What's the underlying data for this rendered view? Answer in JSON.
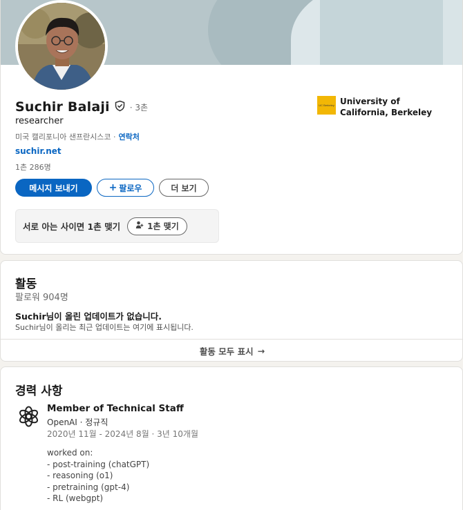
{
  "profile": {
    "name": "Suchir Balaji",
    "degree": "· 3촌",
    "headline": "researcher",
    "location": "미국 캘리포니아 샌프란시스코 ·",
    "contact_label": "연락처",
    "website": "suchir.net",
    "connections": "1촌 286명"
  },
  "actions": {
    "message": "메시지 보내기",
    "follow": "팔로우",
    "follow_icon": "+",
    "more": "더 보기"
  },
  "mutual": {
    "text": "서로 아는 사이면 1촌 맺기",
    "button": "1촌 맺기"
  },
  "education": {
    "name": "University of California, Berkeley",
    "logo_text": "UC Berkeley"
  },
  "activity": {
    "title": "활동",
    "followers": "팔로워 904명",
    "no_updates": "Suchir님이 올린 업데이트가 없습니다.",
    "no_updates_sub": "Suchir님이 올리는 최근 업데이트는 여기에 표시됩니다.",
    "show_all": "활동 모두 표시",
    "show_all_arrow": "→"
  },
  "experience": {
    "title": "경력 사항",
    "items": [
      {
        "role": "Member of Technical Staff",
        "company": "OpenAI · 정규직",
        "dates": "2020년 11월 - 2024년 8월 · 3년 10개월",
        "description": [
          "worked on:",
          "- post-training (chatGPT)",
          "- reasoning (o1)",
          "- pretraining (gpt-4)",
          "- RL (webgpt)"
        ]
      }
    ]
  },
  "colors": {
    "brand_blue": "#0a66c2",
    "education_logo": "#f2b705"
  },
  "icons": [
    "verified-shield-icon",
    "add-person-icon",
    "arrow-right-icon",
    "openai-logo-icon",
    "uc-berkeley-logo"
  ]
}
